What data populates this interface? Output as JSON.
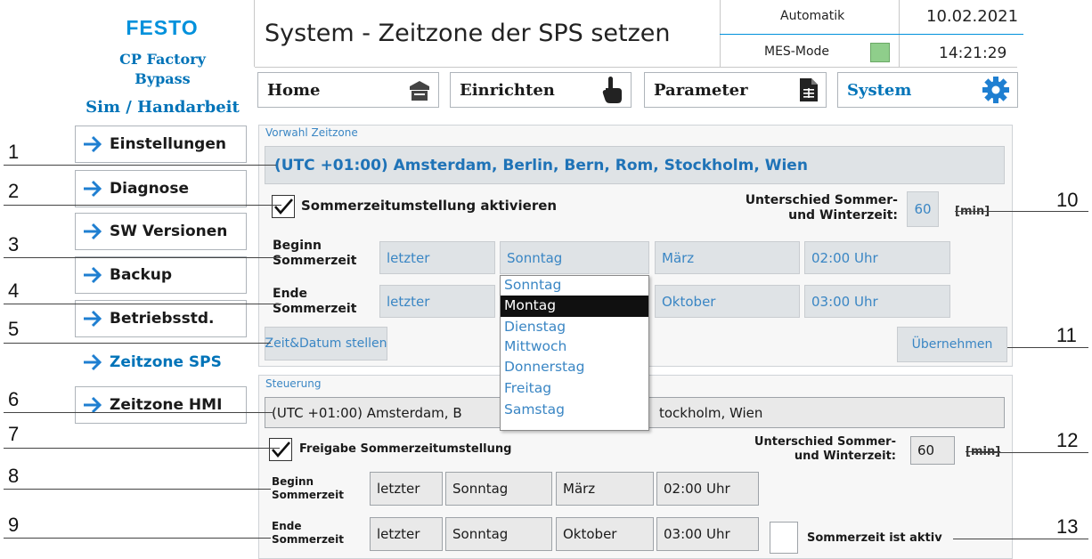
{
  "brand": {
    "logo": "FESTO",
    "station_line1": "CP Factory",
    "station_line2": "Bypass",
    "mode": "Sim / Handarbeit"
  },
  "header": {
    "title": "System - Zeitzone der SPS setzen",
    "status_mode": "Automatik",
    "mes_label": "MES-Mode",
    "mes_indicator_color": "#8fce8b",
    "date": "10.02.2021",
    "time": "14:21:29"
  },
  "nav": [
    {
      "label": "Home",
      "icon": "home-icon"
    },
    {
      "label": "Einrichten",
      "icon": "hand-pointer-icon"
    },
    {
      "label": "Parameter",
      "icon": "document-icon"
    },
    {
      "label": "System",
      "icon": "gear-icon",
      "active": true
    }
  ],
  "sidebar": {
    "items": [
      {
        "label": "Einstellungen"
      },
      {
        "label": "Diagnose"
      },
      {
        "label": "SW Versionen"
      },
      {
        "label": "Backup"
      },
      {
        "label": "Betriebsstd."
      },
      {
        "label": "Zeitzone SPS",
        "active": true
      },
      {
        "label": "Zeitzone HMI"
      }
    ]
  },
  "vorwahl": {
    "title": "Vorwahl Zeitzone",
    "timezone": "(UTC +01:00) Amsterdam, Berlin, Bern, Rom, Stockholm, Wien",
    "dst_checkbox_label": "Sommerzeitumstellung aktivieren",
    "dst_checked": true,
    "diff_label_1": "Unterschied Sommer-",
    "diff_label_2": "und Winterzeit:",
    "diff_value": "60",
    "diff_unit": "[min]",
    "begin_label_1": "Beginn",
    "begin_label_2": "Sommerzeit",
    "begin": {
      "week": "letzter",
      "day": "Sonntag",
      "month": "März",
      "time": "02:00 Uhr"
    },
    "end_label_1": "Ende",
    "end_label_2": "Sommerzeit",
    "end": {
      "week": "letzter",
      "month": "Oktober",
      "time": "03:00 Uhr"
    },
    "set_datetime_button": "Zeit&Datum stellen",
    "apply_button": "Übernehmen"
  },
  "day_dropdown": {
    "options": [
      "Sonntag",
      "Montag",
      "Dienstag",
      "Mittwoch",
      "Donnerstag",
      "Freitag",
      "Samstag"
    ],
    "highlighted": "Montag"
  },
  "steuerung": {
    "title": "Steuerung",
    "timezone_left": "(UTC +01:00) Amsterdam, B",
    "timezone_right": "tockholm, Wien",
    "dst_checkbox_label": "Freigabe Sommerzeitumstellung",
    "dst_checked": true,
    "diff_label_1": "Unterschied Sommer-",
    "diff_label_2": "und Winterzeit:",
    "diff_value": "60",
    "diff_unit": "[min]",
    "begin_label_1": "Beginn",
    "begin_label_2": "Sommerzeit",
    "begin": {
      "week": "letzter",
      "day": "Sonntag",
      "month": "März",
      "time": "02:00 Uhr"
    },
    "end_label_1": "Ende",
    "end_label_2": "Sommerzeit",
    "end": {
      "week": "letzter",
      "day": "Sonntag",
      "month": "Oktober",
      "time": "03:00 Uhr"
    },
    "dst_active_label": "Sommerzeit ist aktiv",
    "dst_active_checked": false
  },
  "callouts": [
    "1",
    "2",
    "3",
    "4",
    "5",
    "6",
    "7",
    "8",
    "9",
    "10",
    "11",
    "12",
    "13"
  ]
}
